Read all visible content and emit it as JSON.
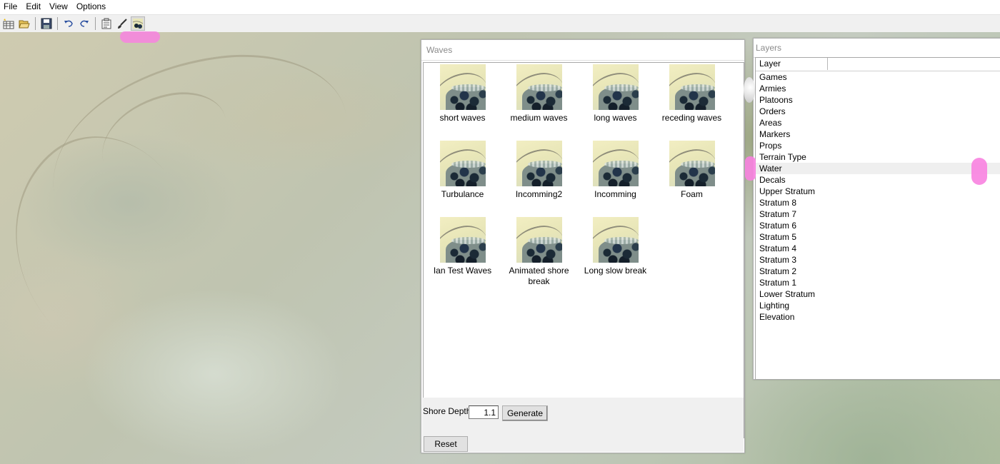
{
  "menu": [
    "File",
    "Edit",
    "View",
    "Options"
  ],
  "toolbar": {
    "buttons": [
      {
        "name": "new-map-icon"
      },
      {
        "name": "open-folder-icon"
      },
      {
        "name": "save-icon"
      },
      {
        "name": "undo-icon"
      },
      {
        "name": "redo-icon"
      },
      {
        "name": "properties-icon"
      },
      {
        "name": "brush-icon"
      },
      {
        "name": "waves-tool-icon",
        "pressed": true
      }
    ]
  },
  "waves_panel": {
    "title": "Waves",
    "items": [
      "short waves",
      "medium waves",
      "long waves",
      "receding waves",
      "Turbulance",
      "Incomming2",
      "Incomming",
      "Foam",
      "Ian Test Waves",
      "Animated shore break",
      "Long slow break"
    ],
    "shore_depth_label": "Shore Depth",
    "shore_depth_value": "1.1",
    "generate_label": "Generate",
    "reset_label": "Reset"
  },
  "layers_panel": {
    "title": "Layers",
    "column_header": "Layer",
    "selected": "Water",
    "layers": [
      "Games",
      "Armies",
      "Platoons",
      "Orders",
      "Areas",
      "Markers",
      "Props",
      "Terrain Type",
      "Water",
      "Decals",
      "Upper Stratum",
      "Stratum 8",
      "Stratum 7",
      "Stratum 6",
      "Stratum 5",
      "Stratum 4",
      "Stratum 3",
      "Stratum 2",
      "Stratum 1",
      "Lower Stratum",
      "Lighting",
      "Elevation"
    ]
  },
  "colors": {
    "annotation_pink": "#f882e0",
    "selection_row": "#efefef",
    "panel_title_text": "#8a8a8a"
  }
}
